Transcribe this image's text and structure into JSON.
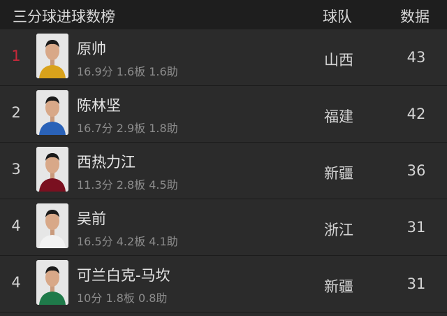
{
  "header": {
    "title": "三分球进球数榜",
    "team_col": "球队",
    "data_col": "数据"
  },
  "colors": {
    "background": "#2b2b2b",
    "header_background": "#1e1e1e",
    "first_rank": "#c8283a",
    "stats_text": "#8c8c8c"
  },
  "players": [
    {
      "rank": "1",
      "name": "原帅",
      "stats": "16.9分 1.6板 1.6助",
      "team": "山西",
      "value": "43",
      "jersey": "#d9a21b"
    },
    {
      "rank": "2",
      "name": "陈林坚",
      "stats": "16.7分 2.9板 1.8助",
      "team": "福建",
      "value": "42",
      "jersey": "#2a62b8"
    },
    {
      "rank": "3",
      "name": "西热力江",
      "stats": "11.3分 2.8板 4.5助",
      "team": "新疆",
      "value": "36",
      "jersey": "#7a1020"
    },
    {
      "rank": "4",
      "name": "吴前",
      "stats": "16.5分 4.2板 4.1助",
      "team": "浙江",
      "value": "31",
      "jersey": "#f2f2f2"
    },
    {
      "rank": "4",
      "name": "可兰白克-马坎",
      "stats": "10分 1.8板 0.8助",
      "team": "新疆",
      "value": "31",
      "jersey": "#1f7a4a"
    }
  ]
}
